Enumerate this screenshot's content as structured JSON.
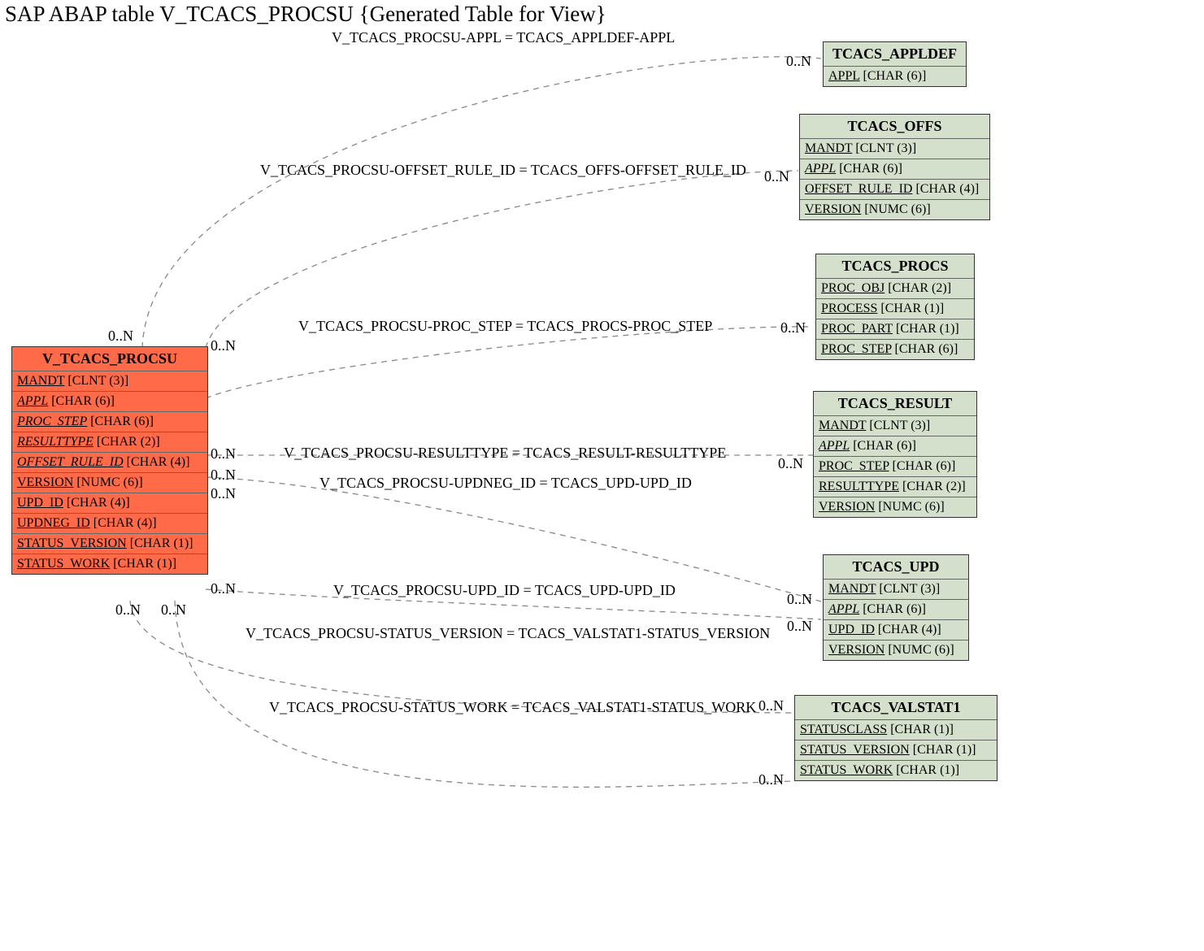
{
  "title": "SAP ABAP table V_TCACS_PROCSU {Generated Table for View}",
  "primary": {
    "name": "V_TCACS_PROCSU",
    "fields": [
      {
        "name": "MANDT",
        "type": "[CLNT (3)]",
        "italic": false
      },
      {
        "name": "APPL",
        "type": "[CHAR (6)]",
        "italic": true
      },
      {
        "name": "PROC_STEP",
        "type": "[CHAR (6)]",
        "italic": true
      },
      {
        "name": "RESULTTYPE",
        "type": "[CHAR (2)]",
        "italic": true
      },
      {
        "name": "OFFSET_RULE_ID",
        "type": "[CHAR (4)]",
        "italic": true
      },
      {
        "name": "VERSION",
        "type": "[NUMC (6)]",
        "italic": false
      },
      {
        "name": "UPD_ID",
        "type": "[CHAR (4)]",
        "italic": false
      },
      {
        "name": "UPDNEG_ID",
        "type": "[CHAR (4)]",
        "italic": false
      },
      {
        "name": "STATUS_VERSION",
        "type": "[CHAR (1)]",
        "italic": false
      },
      {
        "name": "STATUS_WORK",
        "type": "[CHAR (1)]",
        "italic": false
      }
    ]
  },
  "entities": {
    "appldef": {
      "name": "TCACS_APPLDEF",
      "fields": [
        {
          "name": "APPL",
          "type": "[CHAR (6)]",
          "italic": false
        }
      ]
    },
    "offs": {
      "name": "TCACS_OFFS",
      "fields": [
        {
          "name": "MANDT",
          "type": "[CLNT (3)]",
          "italic": false
        },
        {
          "name": "APPL",
          "type": "[CHAR (6)]",
          "italic": true
        },
        {
          "name": "OFFSET_RULE_ID",
          "type": "[CHAR (4)]",
          "italic": false
        },
        {
          "name": "VERSION",
          "type": "[NUMC (6)]",
          "italic": false
        }
      ]
    },
    "procs": {
      "name": "TCACS_PROCS",
      "fields": [
        {
          "name": "PROC_OBJ",
          "type": "[CHAR (2)]",
          "italic": false
        },
        {
          "name": "PROCESS",
          "type": "[CHAR (1)]",
          "italic": false
        },
        {
          "name": "PROC_PART",
          "type": "[CHAR (1)]",
          "italic": false
        },
        {
          "name": "PROC_STEP",
          "type": "[CHAR (6)]",
          "italic": false
        }
      ]
    },
    "result": {
      "name": "TCACS_RESULT",
      "fields": [
        {
          "name": "MANDT",
          "type": "[CLNT (3)]",
          "italic": false
        },
        {
          "name": "APPL",
          "type": "[CHAR (6)]",
          "italic": true
        },
        {
          "name": "PROC_STEP",
          "type": "[CHAR (6)]",
          "italic": false
        },
        {
          "name": "RESULTTYPE",
          "type": "[CHAR (2)]",
          "italic": false
        },
        {
          "name": "VERSION",
          "type": "[NUMC (6)]",
          "italic": false
        }
      ]
    },
    "upd": {
      "name": "TCACS_UPD",
      "fields": [
        {
          "name": "MANDT",
          "type": "[CLNT (3)]",
          "italic": false
        },
        {
          "name": "APPL",
          "type": "[CHAR (6)]",
          "italic": true
        },
        {
          "name": "UPD_ID",
          "type": "[CHAR (4)]",
          "italic": false
        },
        {
          "name": "VERSION",
          "type": "[NUMC (6)]",
          "italic": false
        }
      ]
    },
    "valstat1": {
      "name": "TCACS_VALSTAT1",
      "fields": [
        {
          "name": "STATUSCLASS",
          "type": "[CHAR (1)]",
          "italic": false
        },
        {
          "name": "STATUS_VERSION",
          "type": "[CHAR (1)]",
          "italic": false
        },
        {
          "name": "STATUS_WORK",
          "type": "[CHAR (1)]",
          "italic": false
        }
      ]
    }
  },
  "relations": {
    "appl": "V_TCACS_PROCSU-APPL = TCACS_APPLDEF-APPL",
    "offset": "V_TCACS_PROCSU-OFFSET_RULE_ID = TCACS_OFFS-OFFSET_RULE_ID",
    "procstep": "V_TCACS_PROCSU-PROC_STEP = TCACS_PROCS-PROC_STEP",
    "resulttype": "V_TCACS_PROCSU-RESULTTYPE = TCACS_RESULT-RESULTTYPE",
    "updneg": "V_TCACS_PROCSU-UPDNEG_ID = TCACS_UPD-UPD_ID",
    "upd": "V_TCACS_PROCSU-UPD_ID = TCACS_UPD-UPD_ID",
    "statusv": "V_TCACS_PROCSU-STATUS_VERSION = TCACS_VALSTAT1-STATUS_VERSION",
    "statusw": "V_TCACS_PROCSU-STATUS_WORK = TCACS_VALSTAT1-STATUS_WORK"
  },
  "card": "0..N"
}
